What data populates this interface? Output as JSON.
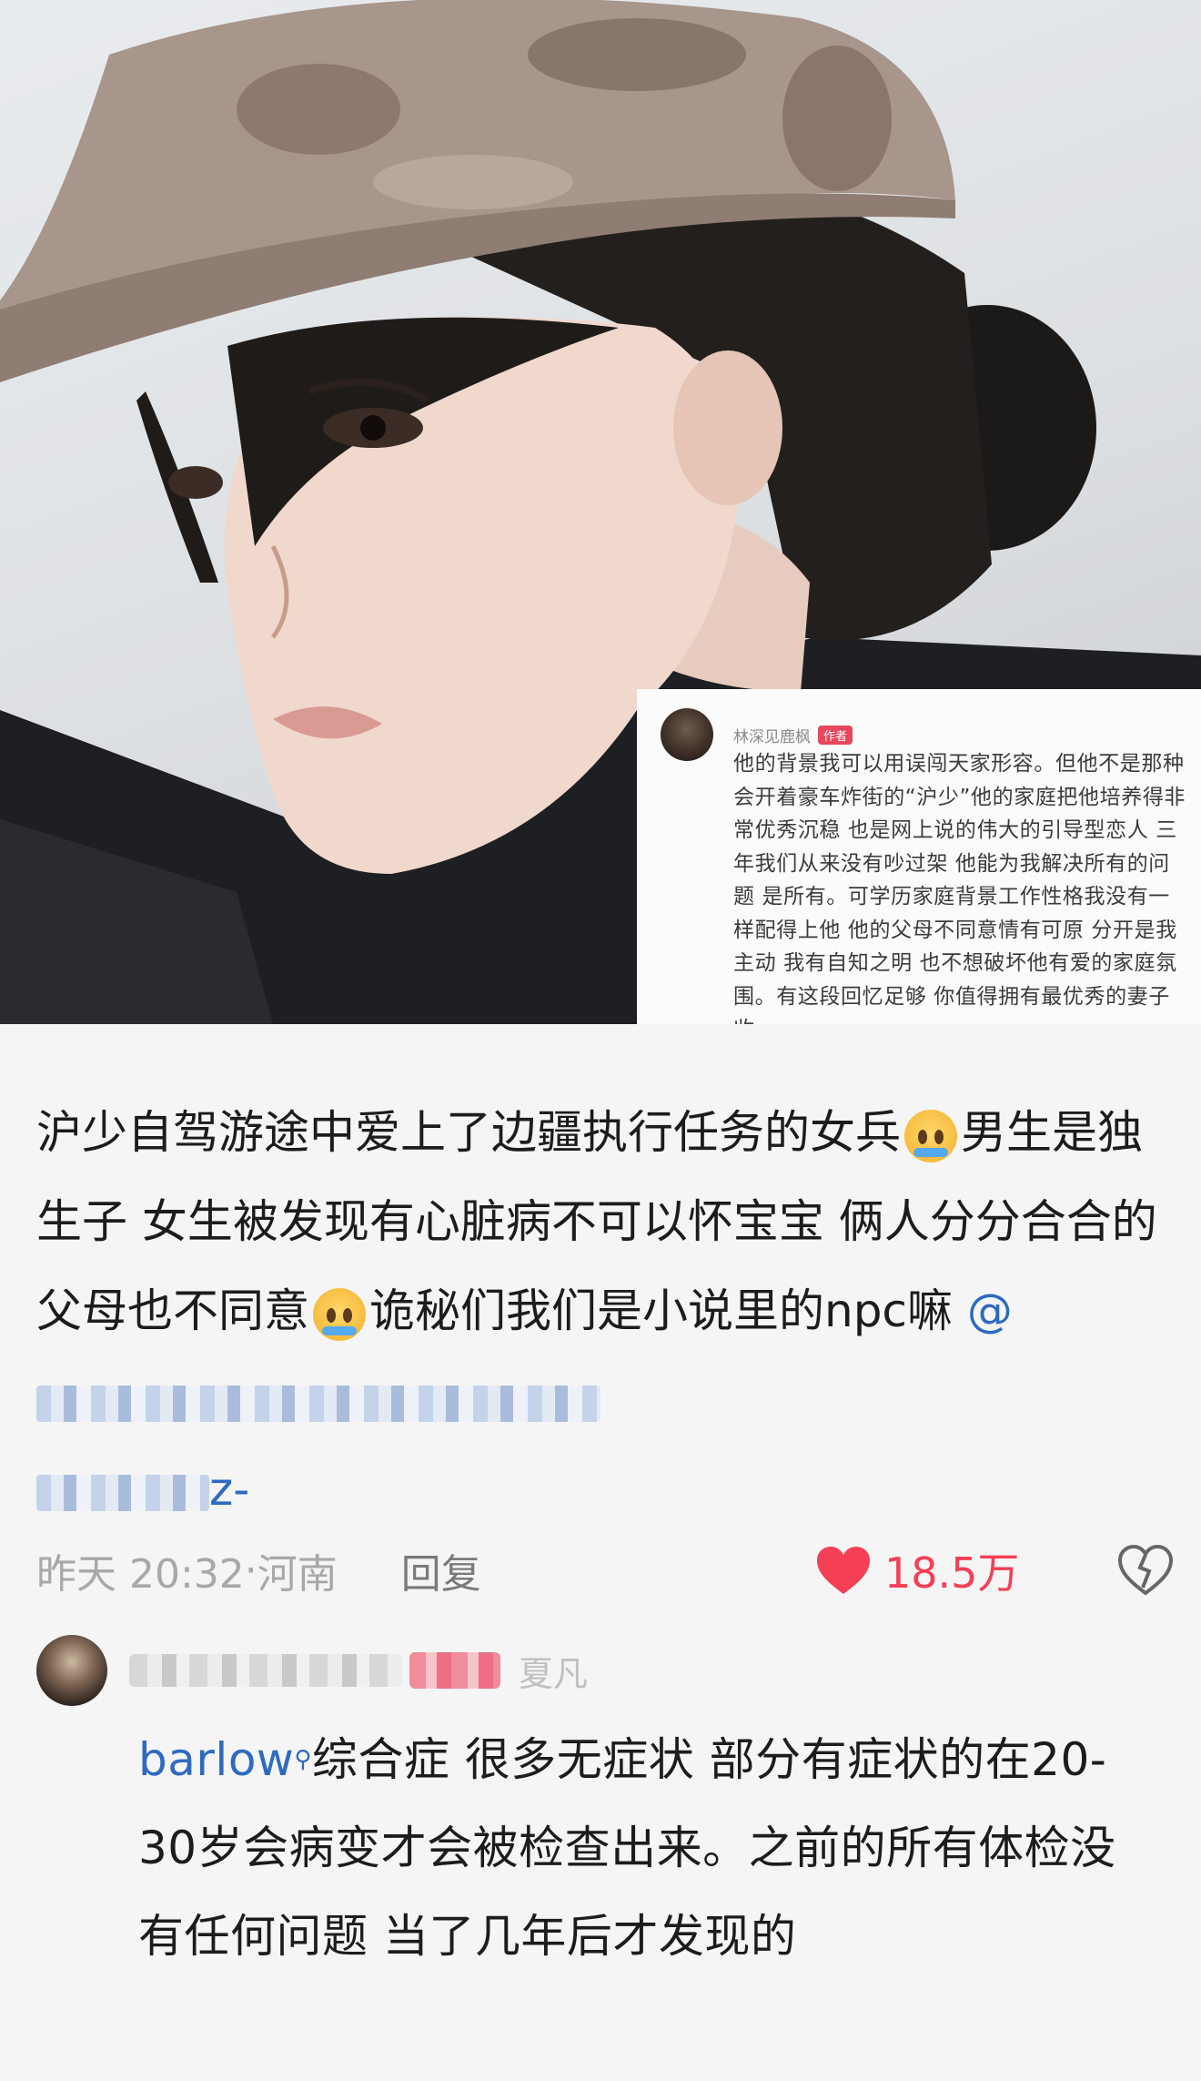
{
  "quoted_comment": {
    "author": "林深见鹿枫",
    "author_tag": "作者",
    "text": "他的背景我可以用误闯天家形容。但他不是那种会开着豪车炸街的“沪少”他的家庭把他培养得非常优秀沉稳 也是网上说的伟大的引导型恋人 三年我们从来没有吵过架 他能为我解决所有的问题 是所有。可学历家庭背景工作性格我没有一样配得上他 他的父母不同意情有可原 分开是我主动 我有自知之明 也不想破坏他有爱的家庭氛围。有这段回忆足够 你值得拥有最优秀的妻子 收"
  },
  "main_comment": {
    "text_part1": "沪少自驾游途中爱上了边疆执行任务的女兵",
    "text_part2": "男生是独生子 女生被发现有心脏病不可以怀宝宝 俩人分分合合的 父母也不同意",
    "text_part3": "诡秘们我们是小说里的npc嘛",
    "mention_prefix": "@",
    "mention_tail": "z-",
    "time": "昨天 20:32",
    "location": "河南",
    "separator": "·",
    "reply_label": "回复",
    "like_count": "18.5万"
  },
  "reply": {
    "name_tail": "夏凡",
    "link_text": "barlow",
    "text": "综合症 很多无症状 部分有症状的在20-30岁会病变才会被检查出来。之前的所有体检没有任何问题 当了几年后才发现的"
  },
  "colors": {
    "like": "#f43f55",
    "link": "#2d6ac1",
    "meta": "#a8a8a8"
  },
  "icons": [
    "heart-icon",
    "broken-heart-icon",
    "search-icon",
    "crying-emoji-icon",
    "sobbing-emoji-icon"
  ]
}
